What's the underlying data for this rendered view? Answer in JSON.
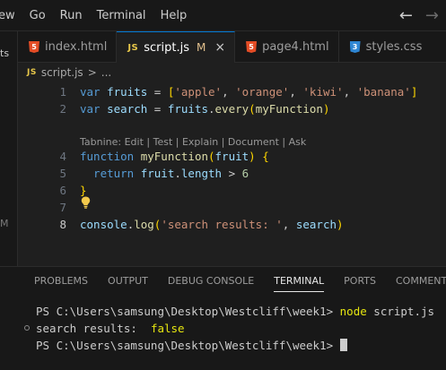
{
  "menubar": {
    "items": [
      "ew",
      "Go",
      "Run",
      "Terminal",
      "Help"
    ],
    "back_arrow": "←",
    "forward_arrow": "→"
  },
  "activity": {
    "mark": "ts",
    "badge": "M"
  },
  "tabs": [
    {
      "label": "index.html",
      "icon": "html5-icon",
      "icon_glyph": "5"
    },
    {
      "label": "script.js",
      "icon": "js-icon",
      "icon_glyph": "JS",
      "badge": "M",
      "close": "×"
    },
    {
      "label": "page4.html",
      "icon": "html5-icon",
      "icon_glyph": "5"
    },
    {
      "label": "styles.css",
      "icon": "css3-icon",
      "icon_glyph": "3"
    }
  ],
  "breadcrumb": {
    "icon": "JS",
    "file": "script.js",
    "separator": ">",
    "more": "..."
  },
  "editor": {
    "line_numbers": [
      "1",
      "2",
      "4",
      "5",
      "6",
      "7",
      "8"
    ],
    "codelens": "Tabnine: Edit | Test | Explain | Document | Ask",
    "lines": [
      [
        [
          "var ",
          "kw"
        ],
        [
          "fruits",
          "var"
        ],
        [
          " = ",
          "pl"
        ],
        [
          "[",
          "br1"
        ],
        [
          "'apple'",
          "str"
        ],
        [
          ", ",
          "pl"
        ],
        [
          "'orange'",
          "str"
        ],
        [
          ", ",
          "pl"
        ],
        [
          "'kiwi'",
          "str"
        ],
        [
          ", ",
          "pl"
        ],
        [
          "'banana'",
          "str"
        ],
        [
          "]",
          "br1"
        ]
      ],
      [
        [
          "var ",
          "kw"
        ],
        [
          "search",
          "var"
        ],
        [
          " = ",
          "pl"
        ],
        [
          "fruits",
          "var"
        ],
        [
          ".",
          "pl"
        ],
        [
          "every",
          "fn"
        ],
        [
          "(",
          "br1"
        ],
        [
          "myFunction",
          "fn"
        ],
        [
          ")",
          "br1"
        ]
      ],
      [
        [
          "function ",
          "kw"
        ],
        [
          "myFunction",
          "fn"
        ],
        [
          "(",
          "br1"
        ],
        [
          "fruit",
          "var"
        ],
        [
          ") ",
          "br1"
        ],
        [
          "{",
          "br1"
        ]
      ],
      [
        [
          "  return ",
          "kw"
        ],
        [
          "fruit",
          "var"
        ],
        [
          ".",
          "pl"
        ],
        [
          "length",
          "var"
        ],
        [
          " > ",
          "pl"
        ],
        [
          "6",
          "num"
        ]
      ],
      [
        [
          "}",
          "br1"
        ]
      ],
      [],
      [
        [
          "console",
          "var"
        ],
        [
          ".",
          "pl"
        ],
        [
          "log",
          "fn"
        ],
        [
          "(",
          "br1"
        ],
        [
          "'search results: '",
          "str"
        ],
        [
          ", ",
          "pl"
        ],
        [
          "search",
          "var"
        ],
        [
          ")",
          "br1"
        ]
      ]
    ]
  },
  "panel": {
    "tabs": [
      "PROBLEMS",
      "OUTPUT",
      "DEBUG CONSOLE",
      "TERMINAL",
      "PORTS",
      "COMMENTS"
    ],
    "active_tab": "TERMINAL"
  },
  "terminal": {
    "prompt1": "PS C:\\Users\\samsung\\Desktop\\Westcliff\\week1> ",
    "command": "node",
    "command_arg": " script.js",
    "output_label": "search results:  ",
    "output_value": "false",
    "prompt2": "PS C:\\Users\\samsung\\Desktop\\Westcliff\\week1> "
  },
  "colors": {
    "accent": "#0078d4",
    "background": "#1f1f1f",
    "modified": "#e2c08d"
  }
}
